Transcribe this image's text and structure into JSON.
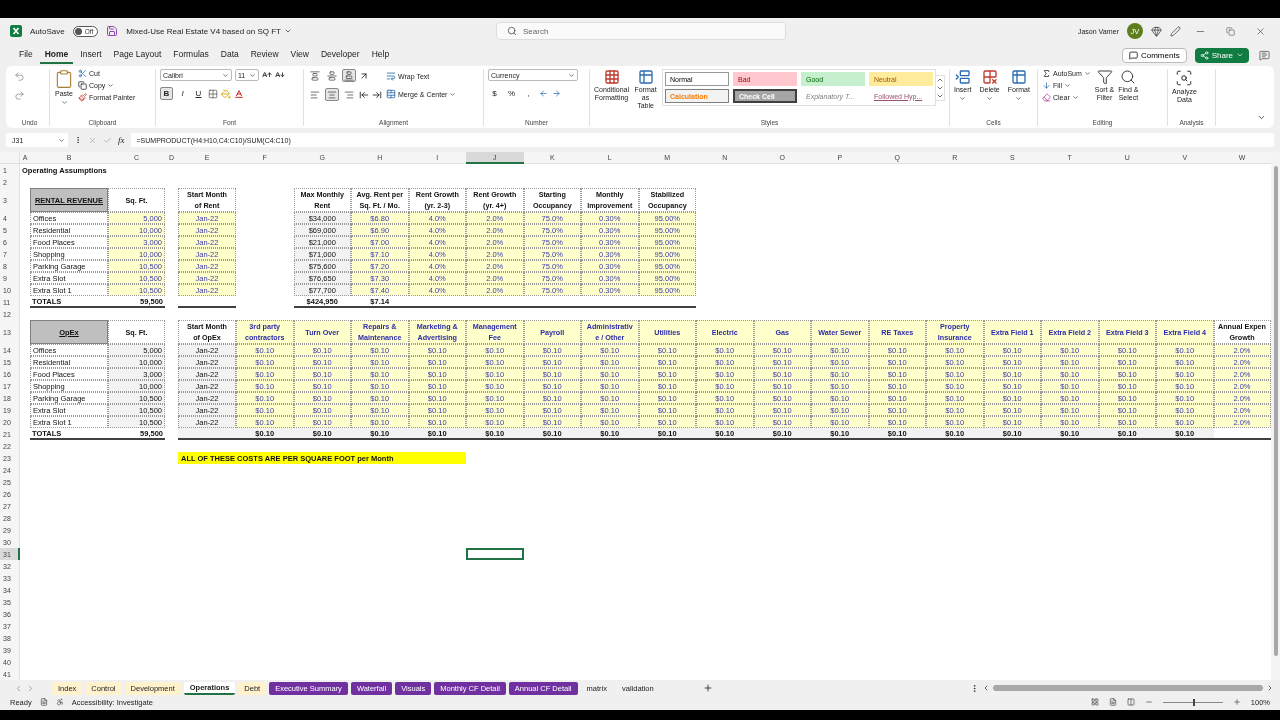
{
  "title_bar": {
    "autosave_label": "AutoSave",
    "autosave_state": "Off",
    "autosave_on": false,
    "file_name": "Mixed-Use Real Estate V4 based on SQ FT",
    "search_placeholder": "Search",
    "user_name": "Jason Varner",
    "user_initials": "JV"
  },
  "menu_tabs": [
    {
      "label": "File",
      "selected": false
    },
    {
      "label": "Home",
      "selected": true
    },
    {
      "label": "Insert",
      "selected": false
    },
    {
      "label": "Page Layout",
      "selected": false
    },
    {
      "label": "Formulas",
      "selected": false
    },
    {
      "label": "Data",
      "selected": false
    },
    {
      "label": "Review",
      "selected": false
    },
    {
      "label": "View",
      "selected": false
    },
    {
      "label": "Developer",
      "selected": false
    },
    {
      "label": "Help",
      "selected": false
    }
  ],
  "comments_button": "Comments",
  "share_button": "Share",
  "ribbon": {
    "undo": {
      "label": "Undo"
    },
    "clipboard": {
      "label": "Clipboard",
      "paste": "Paste",
      "cut": "Cut",
      "copy": "Copy",
      "format_painter": "Format Painter"
    },
    "font": {
      "label": "Font",
      "family": "Calibri",
      "size": "11",
      "style_buttons": [
        {
          "label": "B",
          "pressed": true
        },
        {
          "label": "I",
          "pressed": false
        },
        {
          "label": "U",
          "pressed": false
        }
      ]
    },
    "alignment": {
      "label": "Alignment",
      "vertical_align": [
        {
          "pressed": false
        },
        {
          "pressed": false
        },
        {
          "pressed": true
        }
      ],
      "horizontal_align": [
        {
          "pressed": false
        },
        {
          "pressed": true
        },
        {
          "pressed": false
        }
      ],
      "wrap_text": "Wrap Text",
      "merge_center": "Merge & Center"
    },
    "number": {
      "label": "Number",
      "format": "Currency",
      "buttons": [
        "$",
        "%",
        ","
      ]
    },
    "styles": {
      "label": "Styles",
      "conditional_formatting": "Conditional\nFormatting",
      "format_as_table": "Format as\nTable",
      "cell_styles": [
        {
          "label": "Normal",
          "kind": "normal"
        },
        {
          "label": "Bad",
          "kind": "bad"
        },
        {
          "label": "Good",
          "kind": "good"
        },
        {
          "label": "Neutral",
          "kind": "neutral"
        },
        {
          "label": "Calculation",
          "kind": "calculation"
        },
        {
          "label": "Check Cell",
          "kind": "check"
        },
        {
          "label": "Explanatory T...",
          "kind": "explanatory"
        },
        {
          "label": "Followed Hyp...",
          "kind": "followed"
        }
      ]
    },
    "cells": {
      "label": "Cells",
      "insert": "Insert",
      "delete": "Delete",
      "format": "Format"
    },
    "editing": {
      "label": "Editing",
      "autosum": "AutoSum",
      "fill": "Fill",
      "clear": "Clear",
      "sort_filter": "Sort &\nFilter",
      "find_select": "Find &\nSelect"
    },
    "analysis": {
      "label": "Analysis",
      "analyze_data": "Analyze\nData"
    }
  },
  "formula_bar": {
    "name_box": "J31",
    "fx": "fx",
    "formula": "=SUMPRODUCT(H4:H10,C4:C10)/SUM(C4:C10)"
  },
  "sheet": {
    "columns": [
      {
        "label": "A",
        "selected": false
      },
      {
        "label": "B",
        "selected": false
      },
      {
        "label": "C",
        "selected": false
      },
      {
        "label": "D",
        "selected": false
      },
      {
        "label": "E",
        "selected": false
      },
      {
        "label": "F",
        "selected": false
      },
      {
        "label": "G",
        "selected": false
      },
      {
        "label": "H",
        "selected": false
      },
      {
        "label": "I",
        "selected": false
      },
      {
        "label": "J",
        "selected": true
      },
      {
        "label": "K",
        "selected": false
      },
      {
        "label": "L",
        "selected": false
      },
      {
        "label": "M",
        "selected": false
      },
      {
        "label": "N",
        "selected": false
      },
      {
        "label": "O",
        "selected": false
      },
      {
        "label": "P",
        "selected": false
      },
      {
        "label": "Q",
        "selected": false
      },
      {
        "label": "R",
        "selected": false
      },
      {
        "label": "S",
        "selected": false
      },
      {
        "label": "T",
        "selected": false
      },
      {
        "label": "U",
        "selected": false
      },
      {
        "label": "V",
        "selected": false
      },
      {
        "label": "W",
        "selected": false
      }
    ],
    "rows": [
      {
        "label": "1",
        "selected": false
      },
      {
        "label": "2",
        "selected": false
      },
      {
        "label": "3",
        "selected": false
      },
      {
        "label": "4",
        "selected": false
      },
      {
        "label": "5",
        "selected": false
      },
      {
        "label": "6",
        "selected": false
      },
      {
        "label": "7",
        "selected": false
      },
      {
        "label": "8",
        "selected": false
      },
      {
        "label": "9",
        "selected": false
      },
      {
        "label": "10",
        "selected": false
      },
      {
        "label": "11",
        "selected": false
      },
      {
        "label": "12",
        "selected": false
      },
      {
        "label": "13",
        "selected": false
      },
      {
        "label": "14",
        "selected": false
      },
      {
        "label": "15",
        "selected": false
      },
      {
        "label": "16",
        "selected": false
      },
      {
        "label": "17",
        "selected": false
      },
      {
        "label": "18",
        "selected": false
      },
      {
        "label": "19",
        "selected": false
      },
      {
        "label": "20",
        "selected": false
      },
      {
        "label": "21",
        "selected": false
      },
      {
        "label": "22",
        "selected": false
      },
      {
        "label": "23",
        "selected": false
      },
      {
        "label": "24",
        "selected": false
      },
      {
        "label": "25",
        "selected": false
      },
      {
        "label": "26",
        "selected": false
      },
      {
        "label": "27",
        "selected": false
      },
      {
        "label": "28",
        "selected": false
      },
      {
        "label": "29",
        "selected": false
      },
      {
        "label": "30",
        "selected": false
      },
      {
        "label": "31",
        "selected": true
      },
      {
        "label": "32",
        "selected": false
      },
      {
        "label": "33",
        "selected": false
      },
      {
        "label": "34",
        "selected": false
      },
      {
        "label": "35",
        "selected": false
      },
      {
        "label": "36",
        "selected": false
      },
      {
        "label": "37",
        "selected": false
      },
      {
        "label": "38",
        "selected": false
      },
      {
        "label": "39",
        "selected": false
      },
      {
        "label": "40",
        "selected": false
      },
      {
        "label": "41",
        "selected": false
      }
    ],
    "title": "Operating Assumptions",
    "rental_revenue": {
      "title": "RENTAL REVENUE",
      "sqft_column": {
        "header": "Sq. Ft.",
        "kind": "input"
      },
      "rows": [
        {
          "name": "Offices",
          "sqft": "5,000"
        },
        {
          "name": "Residential",
          "sqft": "10,000"
        },
        {
          "name": "Food Places",
          "sqft": "3,000"
        },
        {
          "name": "Shopping",
          "sqft": "10,000"
        },
        {
          "name": "Parking Garage",
          "sqft": "10,500"
        },
        {
          "name": "Extra Slot",
          "sqft": "10,500"
        },
        {
          "name": "Extra Slot 1",
          "sqft": "10,500"
        }
      ],
      "total_label": "TOTALS",
      "total_sqft": "59,500"
    },
    "rent_start": {
      "header": "Start Month\nof Rent",
      "kind": "input",
      "values": [
        "Jan-22",
        "Jan-22",
        "Jan-22",
        "Jan-22",
        "Jan-22",
        "Jan-22",
        "Jan-22"
      ]
    },
    "rent_assumptions": [
      {
        "header": "Max Monthly\nRent",
        "kind": "calc",
        "values": [
          "$34,000",
          "$69,000",
          "$21,000",
          "$71,000",
          "$75,600",
          "$76,650",
          "$77,700"
        ],
        "total": "$424,950"
      },
      {
        "header": "Avg. Rent per\nSq. Ft. / Mo.",
        "kind": "input",
        "values": [
          "$6.80",
          "$6.90",
          "$7.00",
          "$7.10",
          "$7.20",
          "$7.30",
          "$7.40"
        ],
        "total": "$7.14"
      },
      {
        "header": "Rent Growth\n(yr. 2-3)",
        "kind": "input",
        "values": [
          "4.0%",
          "4.0%",
          "4.0%",
          "4.0%",
          "4.0%",
          "4.0%",
          "4.0%"
        ]
      },
      {
        "header": "Rent Growth\n(yr. 4+)",
        "kind": "input",
        "values": [
          "2.0%",
          "2.0%",
          "2.0%",
          "2.0%",
          "2.0%",
          "2.0%",
          "2.0%"
        ]
      },
      {
        "header": "Starting\nOccupancy",
        "kind": "input",
        "values": [
          "75.0%",
          "75.0%",
          "75.0%",
          "75.0%",
          "75.0%",
          "75.0%",
          "75.0%"
        ]
      },
      {
        "header": "Monthly\nImprovement",
        "kind": "input",
        "values": [
          "0.30%",
          "0.30%",
          "0.30%",
          "0.30%",
          "0.30%",
          "0.30%",
          "0.30%"
        ]
      },
      {
        "header": "Stabilized\nOccupancy",
        "kind": "input",
        "values": [
          "95.00%",
          "95.00%",
          "95.00%",
          "95.00%",
          "95.00%",
          "95.00%",
          "95.00%"
        ]
      }
    ],
    "opex": {
      "title": "OpEx",
      "sqft_column": {
        "header": "Sq. Ft.",
        "kind": "calc"
      },
      "rows": [
        {
          "name": "Offices",
          "sqft": "5,000"
        },
        {
          "name": "Residential",
          "sqft": "10,000"
        },
        {
          "name": "Food Places",
          "sqft": "3,000"
        },
        {
          "name": "Shopping",
          "sqft": "10,000"
        },
        {
          "name": "Parking Garage",
          "sqft": "10,500"
        },
        {
          "name": "Extra Slot",
          "sqft": "10,500"
        },
        {
          "name": "Extra Slot 1",
          "sqft": "10,500"
        }
      ],
      "total_label": "TOTALS",
      "total_sqft": "59,500"
    },
    "opex_start": {
      "header": "Start Month\nof OpEx",
      "kind": "calc",
      "values": [
        "Jan-22",
        "Jan-22",
        "Jan-22",
        "Jan-22",
        "Jan-22",
        "Jan-22",
        "Jan-22"
      ]
    },
    "opex_costs": [
      {
        "header": "3rd party\ncontractors",
        "values": [
          "$0.10",
          "$0.10",
          "$0.10",
          "$0.10",
          "$0.10",
          "$0.10",
          "$0.10"
        ],
        "total": "$0.10"
      },
      {
        "header": "Turn Over",
        "values": [
          "$0.10",
          "$0.10",
          "$0.10",
          "$0.10",
          "$0.10",
          "$0.10",
          "$0.10"
        ],
        "total": "$0.10"
      },
      {
        "header": "Repairs &\nMaintenance",
        "values": [
          "$0.10",
          "$0.10",
          "$0.10",
          "$0.10",
          "$0.10",
          "$0.10",
          "$0.10"
        ],
        "total": "$0.10"
      },
      {
        "header": "Marketing &\nAdvertising",
        "values": [
          "$0.10",
          "$0.10",
          "$0.10",
          "$0.10",
          "$0.10",
          "$0.10",
          "$0.10"
        ],
        "total": "$0.10"
      },
      {
        "header": "Management\nFee",
        "values": [
          "$0.10",
          "$0.10",
          "$0.10",
          "$0.10",
          "$0.10",
          "$0.10",
          "$0.10"
        ],
        "total": "$0.10"
      },
      {
        "header": "Payroll",
        "values": [
          "$0.10",
          "$0.10",
          "$0.10",
          "$0.10",
          "$0.10",
          "$0.10",
          "$0.10"
        ],
        "total": "$0.10"
      },
      {
        "header": "Administrativ\ne / Other",
        "values": [
          "$0.10",
          "$0.10",
          "$0.10",
          "$0.10",
          "$0.10",
          "$0.10",
          "$0.10"
        ],
        "total": "$0.10"
      },
      {
        "header": "Utilities",
        "values": [
          "$0.10",
          "$0.10",
          "$0.10",
          "$0.10",
          "$0.10",
          "$0.10",
          "$0.10"
        ],
        "total": "$0.10"
      },
      {
        "header": "Electric",
        "values": [
          "$0.10",
          "$0.10",
          "$0.10",
          "$0.10",
          "$0.10",
          "$0.10",
          "$0.10"
        ],
        "total": "$0.10"
      },
      {
        "header": "Gas",
        "values": [
          "$0.10",
          "$0.10",
          "$0.10",
          "$0.10",
          "$0.10",
          "$0.10",
          "$0.10"
        ],
        "total": "$0.10"
      },
      {
        "header": "Water Sewer",
        "values": [
          "$0.10",
          "$0.10",
          "$0.10",
          "$0.10",
          "$0.10",
          "$0.10",
          "$0.10"
        ],
        "total": "$0.10"
      },
      {
        "header": "RE Taxes",
        "values": [
          "$0.10",
          "$0.10",
          "$0.10",
          "$0.10",
          "$0.10",
          "$0.10",
          "$0.10"
        ],
        "total": "$0.10"
      },
      {
        "header": "Property\nInsurance",
        "values": [
          "$0.10",
          "$0.10",
          "$0.10",
          "$0.10",
          "$0.10",
          "$0.10",
          "$0.10"
        ],
        "total": "$0.10"
      },
      {
        "header": "Extra Field 1",
        "values": [
          "$0.10",
          "$0.10",
          "$0.10",
          "$0.10",
          "$0.10",
          "$0.10",
          "$0.10"
        ],
        "total": "$0.10"
      },
      {
        "header": "Extra Field 2",
        "values": [
          "$0.10",
          "$0.10",
          "$0.10",
          "$0.10",
          "$0.10",
          "$0.10",
          "$0.10"
        ],
        "total": "$0.10"
      },
      {
        "header": "Extra Field 3",
        "values": [
          "$0.10",
          "$0.10",
          "$0.10",
          "$0.10",
          "$0.10",
          "$0.10",
          "$0.10"
        ],
        "total": "$0.10"
      },
      {
        "header": "Extra Field 4",
        "values": [
          "$0.10",
          "$0.10",
          "$0.10",
          "$0.10",
          "$0.10",
          "$0.10",
          "$0.10"
        ],
        "total": "$0.10"
      }
    ],
    "opex_growth": {
      "header": "Annual Expen\nGrowth",
      "values": [
        "2.0%",
        "2.0%",
        "2.0%",
        "2.0%",
        "2.0%",
        "2.0%",
        "2.0%"
      ]
    },
    "note": "ALL OF THESE COSTS ARE PER SQUARE FOOT per Month"
  },
  "sheet_tabs": [
    {
      "label": "Index",
      "selected": false,
      "color": "#fff2cc"
    },
    {
      "label": "Control",
      "selected": false,
      "color": "#fff2cc"
    },
    {
      "label": "Development",
      "selected": false,
      "color": "#fff2cc"
    },
    {
      "label": "Operations",
      "selected": true
    },
    {
      "label": "Debt",
      "selected": false,
      "color": "#fff2cc"
    },
    {
      "label": "Executive Summary",
      "selected": false,
      "color": "#7030a0"
    },
    {
      "label": "Waterfall",
      "selected": false,
      "color": "#7030a0"
    },
    {
      "label": "Visuals",
      "selected": false,
      "color": "#7030a0"
    },
    {
      "label": "Monthly CF Detail",
      "selected": false,
      "color": "#7030a0"
    },
    {
      "label": "Annual CF Detail",
      "selected": false,
      "color": "#7030a0"
    },
    {
      "label": "matrix",
      "selected": false
    },
    {
      "label": "validation",
      "selected": false
    }
  ],
  "status_bar": {
    "status": "Ready",
    "accessibility": "Accessibility: Investigate",
    "zoom": {
      "level": 0.5,
      "reading": "100%"
    }
  }
}
